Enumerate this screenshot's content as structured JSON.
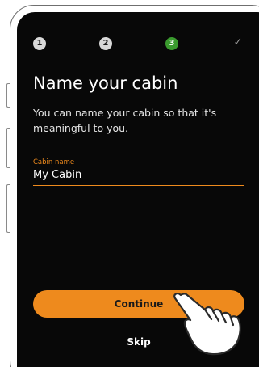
{
  "stepper": {
    "steps": [
      {
        "number": "1",
        "state": "done"
      },
      {
        "number": "2",
        "state": "done"
      },
      {
        "number": "3",
        "state": "current"
      }
    ],
    "final_icon": "check-icon",
    "active_color": "#3a9b2e"
  },
  "onboarding": {
    "title": "Name your cabin",
    "description": "You can name your cabin so that it's meaningful to you."
  },
  "cabin_name": {
    "label": "Cabin name",
    "value": "My Cabin"
  },
  "actions": {
    "continue_label": "Continue",
    "skip_label": "Skip"
  },
  "colors": {
    "accent": "#ee8a1d",
    "screen_background": "#080808"
  },
  "overlay": {
    "icon": "pointing-hand-icon"
  }
}
